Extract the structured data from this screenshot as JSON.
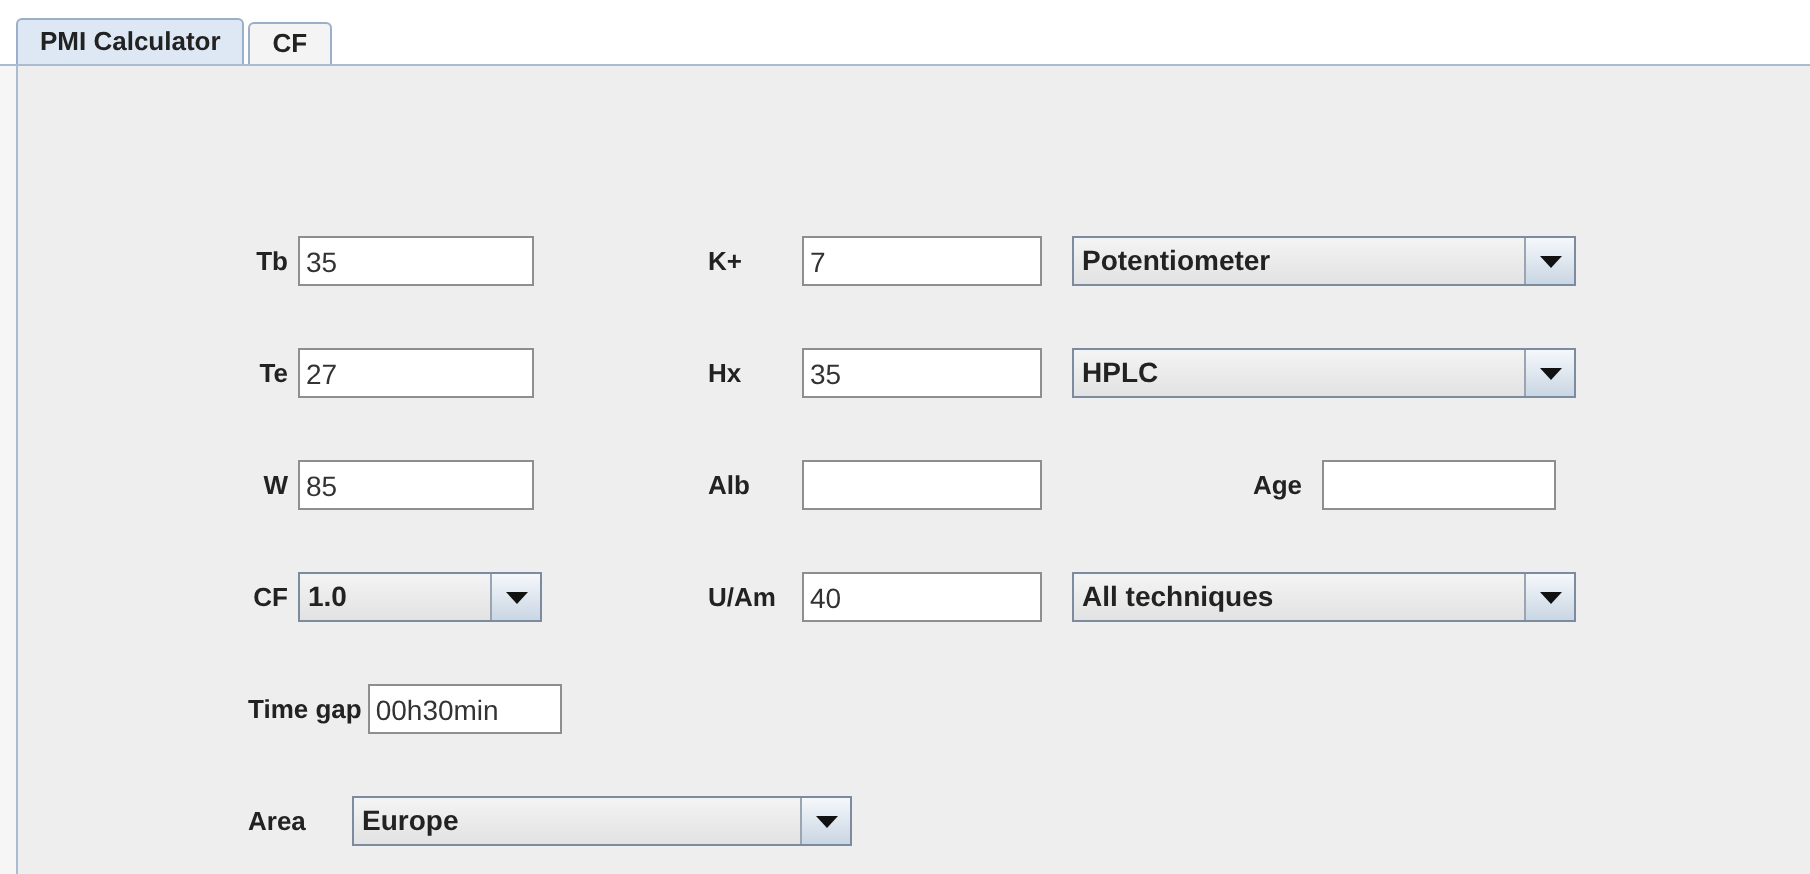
{
  "tabs": [
    {
      "label": "PMI Calculator",
      "selected": true
    },
    {
      "label": "CF",
      "selected": false
    }
  ],
  "form": {
    "tb": {
      "label": "Tb",
      "value": "35"
    },
    "te": {
      "label": "Te",
      "value": "27"
    },
    "w": {
      "label": "W",
      "value": "85"
    },
    "cf": {
      "label": "CF",
      "value": "1.0"
    },
    "k": {
      "label": "K+",
      "value": "7"
    },
    "k_method": {
      "value": "Potentiometer"
    },
    "hx": {
      "label": "Hx",
      "value": "35"
    },
    "hx_method": {
      "value": "HPLC"
    },
    "alb": {
      "label": "Alb"
    },
    "age": {
      "label": "Age"
    },
    "u_am": {
      "label": "U/Am",
      "value": "40"
    },
    "u_am_method": {
      "value": "All techniques"
    },
    "time_gap": {
      "label": "Time gap",
      "value": "00h30min"
    },
    "area": {
      "label": "Area",
      "value": "Europe"
    }
  }
}
